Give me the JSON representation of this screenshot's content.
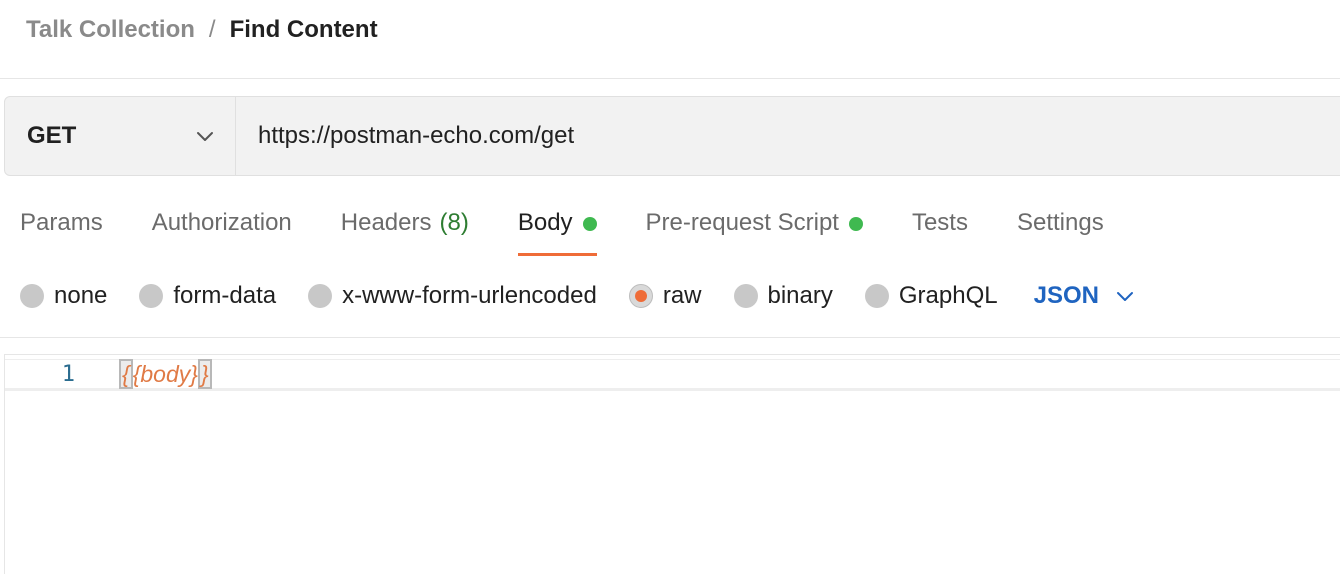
{
  "breadcrumb": {
    "parent": "Talk Collection",
    "separator": "/",
    "current": "Find Content"
  },
  "request": {
    "method": "GET",
    "url": "https://postman-echo.com/get"
  },
  "tabs": [
    {
      "label": "Params"
    },
    {
      "label": "Authorization"
    },
    {
      "label": "Headers",
      "count": "(8)"
    },
    {
      "label": "Body",
      "active": true,
      "indicator": true
    },
    {
      "label": "Pre-request Script",
      "indicator": true
    },
    {
      "label": "Tests"
    },
    {
      "label": "Settings"
    }
  ],
  "body_types": {
    "options": [
      "none",
      "form-data",
      "x-www-form-urlencoded",
      "raw",
      "binary",
      "GraphQL"
    ],
    "selected": "raw",
    "format": "JSON"
  },
  "editor": {
    "line_number": "1",
    "open_brace": "{",
    "content": "{body}",
    "close_brace": "}"
  },
  "colors": {
    "accent": "#ef6c38",
    "indicator": "#3fb950",
    "format_link": "#1f64c0",
    "headers_count": "#2e7d32"
  }
}
